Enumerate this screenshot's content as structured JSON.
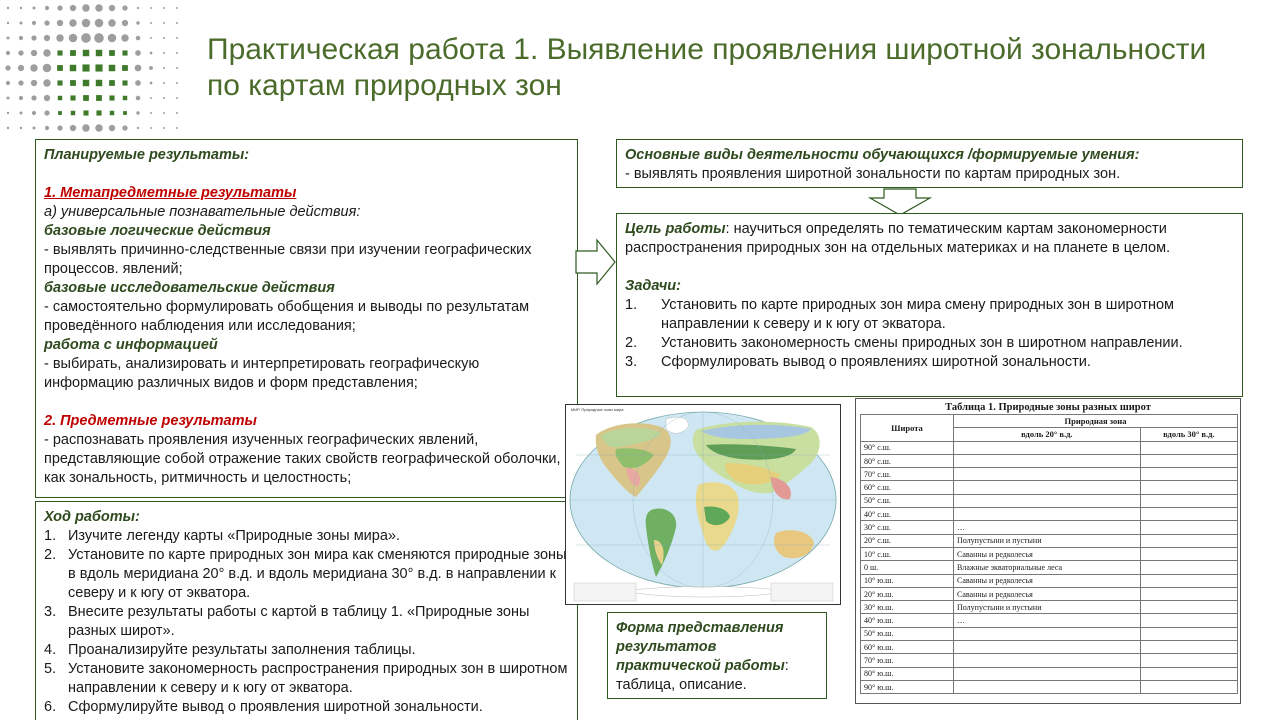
{
  "title": "Практическая работа 1.  Выявление проявления широтной зональности по картам природных зон",
  "logo": {
    "icon": "dot-grid-logo",
    "colors": [
      "#9e9e9e",
      "#3f7a2a"
    ]
  },
  "planned": {
    "heading": "Планируемые результаты:",
    "meta_heading": "1. Метапредметные результаты",
    "ucd": "а) универсальные познавательные действия:",
    "logic_heading": "базовые логические действия",
    "logic_text": "- выявлять причинно-следственные  связи при изучении географических процессов. явлений;",
    "research_heading": "базовые исследовательские  действия",
    "research_text": "- самостоятельно формулировать обобщения  и выводы по результатам проведённого наблюдения  или  исследования;",
    "info_heading": "работа с информацией",
    "info_text": "- выбирать, анализировать  и интерпретировать  географическую  информацию  различных  видов и форм  представления;",
    "subject_heading": "2. Предметные результаты",
    "subject_text": "- распознавать проявления изученных  географических явлений, представляющие  собой отражение  таких свойств географической оболочки,  как зональность,  ритмичность  и целостность;"
  },
  "activities": {
    "heading": "Основные виды деятельности обучающихся /формируемые умения:",
    "text": "- выявлять проявления широтной  зональности  по картам природных  зон."
  },
  "goal": {
    "label": "Цель работы",
    "text": ": научиться  определять по тематическим  картам закономерности распространения  природных зон на отдельных  материках и на планете  в целом.",
    "tasks_heading": "Задачи:",
    "tasks": [
      {
        "n": "1.",
        "t": "Установить по карте природных зон мира смену природных  зон в широтном направлении  к северу и к югу от экватора."
      },
      {
        "n": "2.",
        "t": "Установить закономерность  смены природных  зон в широтном направлении."
      },
      {
        "n": "3.",
        "t": "Сформулировать вывод о проявлениях  широтной  зональности."
      }
    ]
  },
  "progress": {
    "heading": "Ход работы:",
    "steps": [
      {
        "n": "1.",
        "t": "Изучите легенду  карты «Природные зоны мира»."
      },
      {
        "n": "2.",
        "t": "Установите по карте природных зон мира как сменяются природные зоны в вдоль меридиана  20° в.д. и вдоль меридиана 30° в.д. в направлении  к северу и к югу от экватора."
      },
      {
        "n": "3.",
        "t": "Внесите результаты работы с картой в таблицу  1. «Природные зоны разных широт»."
      },
      {
        "n": "4.",
        "t": "Проанализируйте  результаты заполнения  таблицы."
      },
      {
        "n": "5.",
        "t": "Установите закономерность распространения природных  зон в широтном  направлении  к северу и к югу от экватора."
      },
      {
        "n": "6.",
        "t": "Сформулируйте  вывод о проявления широтной  зональности."
      }
    ]
  },
  "form": {
    "heading": "Форма представления результатов практической  работы",
    "colon": ":",
    "text": "таблица,  описание."
  },
  "map": {
    "caption": "МИР. Природные зоны мира",
    "icon": "world-natural-zones-map"
  },
  "table": {
    "title": "Таблица 1. Природные зоны разных широт",
    "col_lat": "Широта",
    "col_zone": "Природная зона",
    "col_20": "вдоль 20° в.д.",
    "col_30": "вдоль 30° в.д.",
    "rows": [
      {
        "lat": "90° с.ш.",
        "z20": "",
        "z30": ""
      },
      {
        "lat": "80° с.ш.",
        "z20": "",
        "z30": ""
      },
      {
        "lat": "70° с.ш.",
        "z20": "",
        "z30": ""
      },
      {
        "lat": "60° с.ш.",
        "z20": "",
        "z30": ""
      },
      {
        "lat": "50° с.ш.",
        "z20": "",
        "z30": ""
      },
      {
        "lat": "40° с.ш.",
        "z20": "",
        "z30": ""
      },
      {
        "lat": "30° с.ш.",
        "z20": "…",
        "z30": ""
      },
      {
        "lat": "20° с.ш.",
        "z20": "Полупустыни и пустыни",
        "z30": ""
      },
      {
        "lat": "10° с.ш.",
        "z20": "Саванны и редколесья",
        "z30": ""
      },
      {
        "lat": "0 ш.",
        "z20": "Влажные экваториальные леса",
        "z30": ""
      },
      {
        "lat": "10° ю.ш.",
        "z20": "Саванны и редколесья",
        "z30": ""
      },
      {
        "lat": "20° ю.ш.",
        "z20": "Саванны и редколесья",
        "z30": ""
      },
      {
        "lat": "30° ю.ш.",
        "z20": "Полупустыни и пустыни",
        "z30": ""
      },
      {
        "lat": "40° ю.ш.",
        "z20": "…",
        "z30": ""
      },
      {
        "lat": "50° ю.ш.",
        "z20": "",
        "z30": ""
      },
      {
        "lat": "60° ю.ш.",
        "z20": "",
        "z30": ""
      },
      {
        "lat": "70° ю.ш.",
        "z20": "",
        "z30": ""
      },
      {
        "lat": "80° ю.ш.",
        "z20": "",
        "z30": ""
      },
      {
        "lat": "90° ю.ш.",
        "z20": "",
        "z30": ""
      }
    ]
  },
  "colors": {
    "title": "#4a6b2a",
    "border": "#2e5a1e",
    "red": "#c00000"
  }
}
